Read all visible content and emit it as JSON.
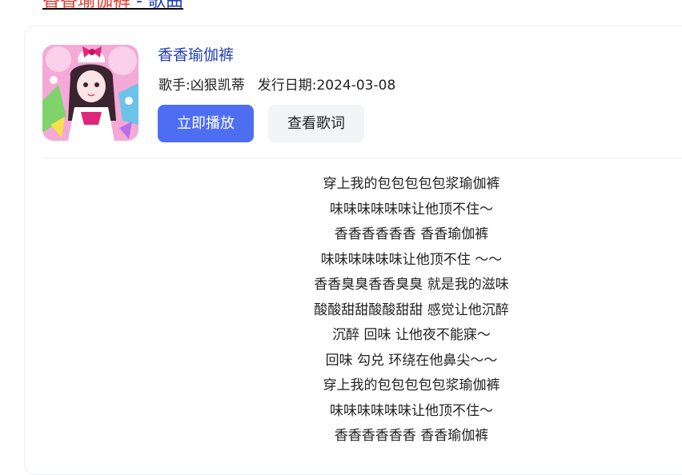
{
  "header": {
    "title_song": "香香瑜伽裤",
    "title_suffix": " - 歌曲"
  },
  "song": {
    "name": "香香瑜伽裤",
    "singer_label": "歌手:凶狠凯蒂",
    "release_label": "发行日期:2024-03-08",
    "cover_icon": "album-cover-anime-girl"
  },
  "buttons": {
    "play": "立即播放",
    "view_lyrics": "查看歌词"
  },
  "lyrics": [
    "穿上我的包包包包包浆瑜伽裤",
    "味味味味味味让他顶不住～",
    "香香香香香香 香香瑜伽裤",
    "味味味味味味让他顶不住 ～～",
    "香香臭臭香香臭臭 就是我的滋味",
    "酸酸甜甜酸酸甜甜 感觉让他沉醉",
    "沉醉 回味 让他夜不能寐～",
    "回味 勾兑 环绕在他鼻尖～～",
    "穿上我的包包包包包浆瑜伽裤",
    "味味味味味味让他顶不住～",
    "香香香香香香 香香瑜伽裤"
  ],
  "colors": {
    "title_red": "#e8382b",
    "link_blue": "#2440b3",
    "button_blue": "#4e6ef2"
  }
}
